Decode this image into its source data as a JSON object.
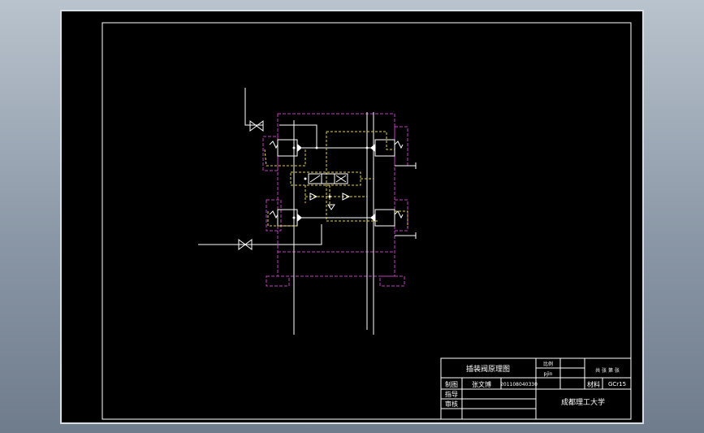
{
  "colors": {
    "background": "#000000",
    "line_white": "#ffffff",
    "line_magenta": "#c040c0",
    "line_yellow": "#e6d23c"
  },
  "title_block": {
    "drawing_title": "插装阀原理图",
    "ratio_label": "比例",
    "ratio_value": "pjin",
    "sheet_info": "共 张  第 张",
    "drawn_label": "制图",
    "drawn_name": "张文博",
    "student_id": "201108040330",
    "material_label": "材料",
    "material_value": "GCr15",
    "guide_label": "指导",
    "review_label": "审核",
    "school": "成都理工大学"
  }
}
